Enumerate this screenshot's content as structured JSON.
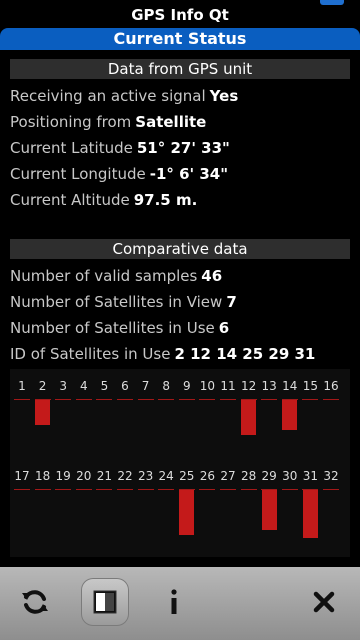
{
  "app": {
    "title": "GPS Info Qt"
  },
  "status_bar": {
    "label": "Current Status"
  },
  "gps_section": {
    "header": "Data from GPS unit",
    "rows": [
      {
        "label": "Receiving an active signal",
        "value": "Yes"
      },
      {
        "label": "Positioning from",
        "value": "Satellite"
      },
      {
        "label": "Current Latitude",
        "value": "51° 27' 33\""
      },
      {
        "label": "Current Longitude",
        "value": "-1° 6' 34\""
      },
      {
        "label": "Current Altitude",
        "value": "97.5 m."
      }
    ]
  },
  "comparative_section": {
    "header": "Comparative data",
    "rows": [
      {
        "label": "Number of valid samples",
        "value": "46"
      },
      {
        "label": "Number of Satellites in View",
        "value": "7"
      },
      {
        "label": "Number of Satellites in Use",
        "value": "6"
      },
      {
        "label": "ID of Satellites in Use",
        "value": "2 12 14 25 29 31"
      }
    ]
  },
  "satellites": {
    "ids": [
      "1",
      "2",
      "3",
      "4",
      "5",
      "6",
      "7",
      "8",
      "9",
      "10",
      "11",
      "12",
      "13",
      "14",
      "15",
      "16",
      "17",
      "18",
      "19",
      "20",
      "21",
      "22",
      "23",
      "24",
      "25",
      "26",
      "27",
      "28",
      "29",
      "30",
      "31",
      "32"
    ],
    "strength_levels": {
      "2": 0.5,
      "12": 0.7,
      "14": 0.6,
      "25": 0.9,
      "29": 0.8,
      "31": 0.95
    },
    "bar_color": "#c41a1a"
  },
  "toolbar": {
    "refresh_icon": "refresh-icon",
    "view_icon": "view-toggle-icon",
    "info_icon": "info-icon",
    "close_icon": "close-icon"
  }
}
